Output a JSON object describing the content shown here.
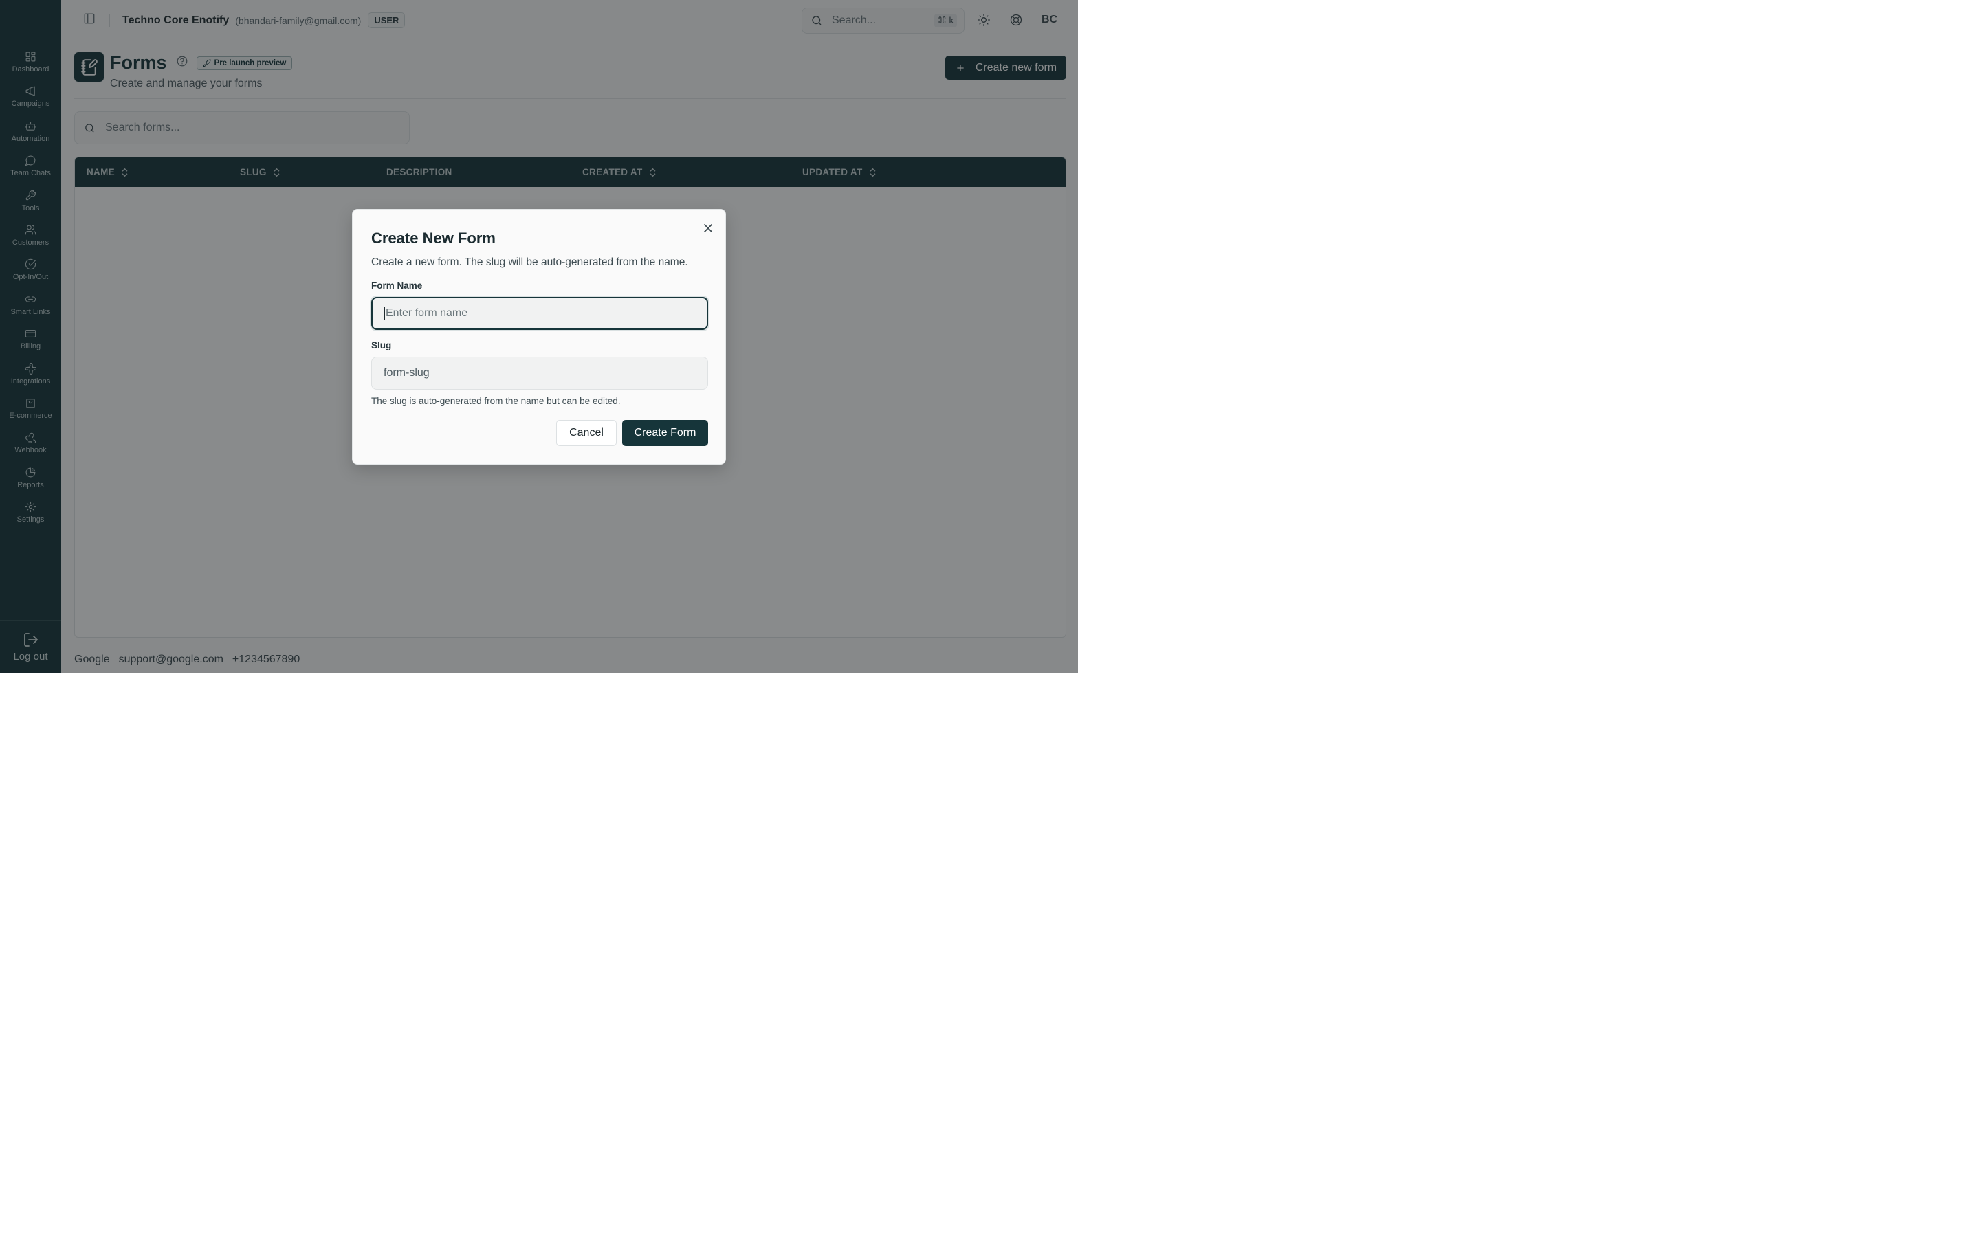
{
  "sidebar": {
    "items": [
      {
        "label": "Dashboard",
        "icon": "dashboard-icon"
      },
      {
        "label": "Campaigns",
        "icon": "megaphone-icon"
      },
      {
        "label": "Automation",
        "icon": "bot-icon"
      },
      {
        "label": "Team Chats",
        "icon": "chat-icon"
      },
      {
        "label": "Tools",
        "icon": "wrench-icon"
      },
      {
        "label": "Customers",
        "icon": "users-icon"
      },
      {
        "label": "Opt-In/Out",
        "icon": "check-circle-icon"
      },
      {
        "label": "Smart Links",
        "icon": "link-icon"
      },
      {
        "label": "Billing",
        "icon": "credit-card-icon"
      },
      {
        "label": "Integrations",
        "icon": "puzzle-icon"
      },
      {
        "label": "E-commerce",
        "icon": "shopping-bag-icon"
      },
      {
        "label": "Webhook",
        "icon": "webhook-icon"
      },
      {
        "label": "Reports",
        "icon": "pie-chart-icon"
      },
      {
        "label": "Settings",
        "icon": "gear-icon"
      }
    ],
    "logout_label": "Log out"
  },
  "topbar": {
    "org_name": "Techno Core Enotify",
    "org_email": "(bhandari-family@gmail.com)",
    "role_badge": "USER",
    "search_placeholder": "Search...",
    "search_shortcut": "⌘ k",
    "avatar_initials": "BC"
  },
  "page": {
    "title": "Forms",
    "badge": "Pre launch preview",
    "subtitle": "Create and manage your forms",
    "create_button": "Create new form",
    "search_placeholder": "Search forms..."
  },
  "table": {
    "columns": [
      "NAME",
      "SLUG",
      "DESCRIPTION",
      "CREATED AT",
      "UPDATED AT"
    ]
  },
  "footer": {
    "company": "Google",
    "email": "support@google.com",
    "phone": "+1234567890"
  },
  "modal": {
    "title": "Create New Form",
    "description": "Create a new form. The slug will be auto-generated from the name.",
    "form_name_label": "Form Name",
    "form_name_placeholder": "Enter form name",
    "slug_label": "Slug",
    "slug_placeholder": "form-slug",
    "helper_text": "The slug is auto-generated from the name but can be edited.",
    "cancel_label": "Cancel",
    "submit_label": "Create Form"
  },
  "colors": {
    "brand": "#16353a",
    "overlay": "rgba(20,24,26,0.5)"
  }
}
